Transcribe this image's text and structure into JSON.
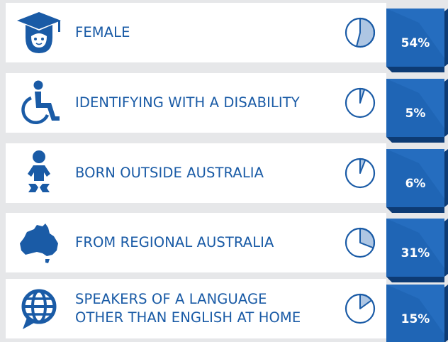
{
  "colors": {
    "primary": "#1a5ba6",
    "pie_fill": "#aec6e3",
    "ribbon_light": "#1f65b5",
    "ribbon_dark": "#0d3b74",
    "card": "#ffffff",
    "background": "#e6e7e9"
  },
  "chart_data": {
    "type": "pie",
    "unit": "%",
    "categories": [
      "FEMALE",
      "IDENTIFYING WITH A DISABILITY",
      "BORN OUTSIDE AUSTRALIA",
      "FROM REGIONAL AUSTRALIA",
      "SPEAKERS OF A LANGUAGE\nOTHER THAN ENGLISH AT HOME"
    ],
    "values": [
      54,
      5,
      6,
      31,
      15
    ],
    "value_labels": [
      "54%",
      "5%",
      "6%",
      "31%",
      "15%"
    ],
    "icons": [
      "graduate-icon",
      "wheelchair-icon",
      "baby-icon",
      "australia-map-icon",
      "globe-chat-icon"
    ]
  }
}
